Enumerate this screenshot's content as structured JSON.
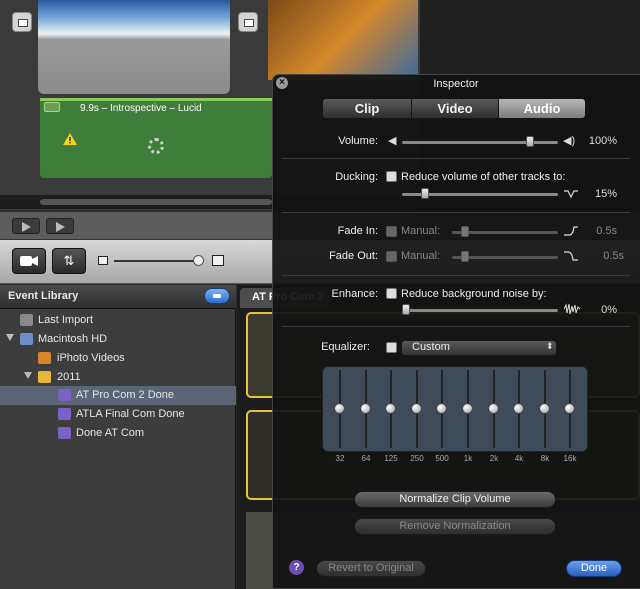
{
  "timeline": {
    "clip_title": "9.9s – Introspective – Lucid"
  },
  "event_library": {
    "title": "Event Library",
    "items": [
      {
        "label": "Last Import"
      },
      {
        "label": "Macintosh HD"
      },
      {
        "label": "iPhoto Videos"
      },
      {
        "label": "2011"
      },
      {
        "label": "AT Pro Com 2 Done"
      },
      {
        "label": "ATLA Final Com Done"
      },
      {
        "label": "Done AT Com"
      }
    ]
  },
  "browser": {
    "tab_label": "AT Pro Com 2"
  },
  "inspector": {
    "title": "Inspector",
    "tabs": [
      {
        "label": "Clip"
      },
      {
        "label": "Video"
      },
      {
        "label": "Audio"
      }
    ],
    "active_tab": "Audio",
    "volume": {
      "label": "Volume:",
      "value_text": "100%",
      "level": 0.82
    },
    "ducking": {
      "label": "Ducking:",
      "checkbox_label": "Reduce volume of other tracks to:",
      "value_text": "15%",
      "level": 0.15
    },
    "fade_in": {
      "label": "Fade In:",
      "manual_label": "Manual:",
      "value_text": "0.5s"
    },
    "fade_out": {
      "label": "Fade Out:",
      "manual_label": "Manual:",
      "value_text": "0.5s"
    },
    "enhance": {
      "label": "Enhance:",
      "checkbox_label": "Reduce background noise by:",
      "value_text": "0%"
    },
    "equalizer": {
      "label": "Equalizer:",
      "preset": "Custom",
      "bands": [
        "32",
        "64",
        "125",
        "250",
        "500",
        "1k",
        "2k",
        "4k",
        "8k",
        "16k"
      ]
    },
    "buttons": {
      "normalize": "Normalize Clip Volume",
      "remove_normalization": "Remove Normalization",
      "revert": "Revert to Original",
      "done": "Done",
      "help": "?"
    }
  },
  "colors": {
    "selected_row": "#5a6575",
    "done_button": "#2a5fbf",
    "clip_green": "#3f7d3a",
    "filmstrip_border": "#e7c335"
  }
}
